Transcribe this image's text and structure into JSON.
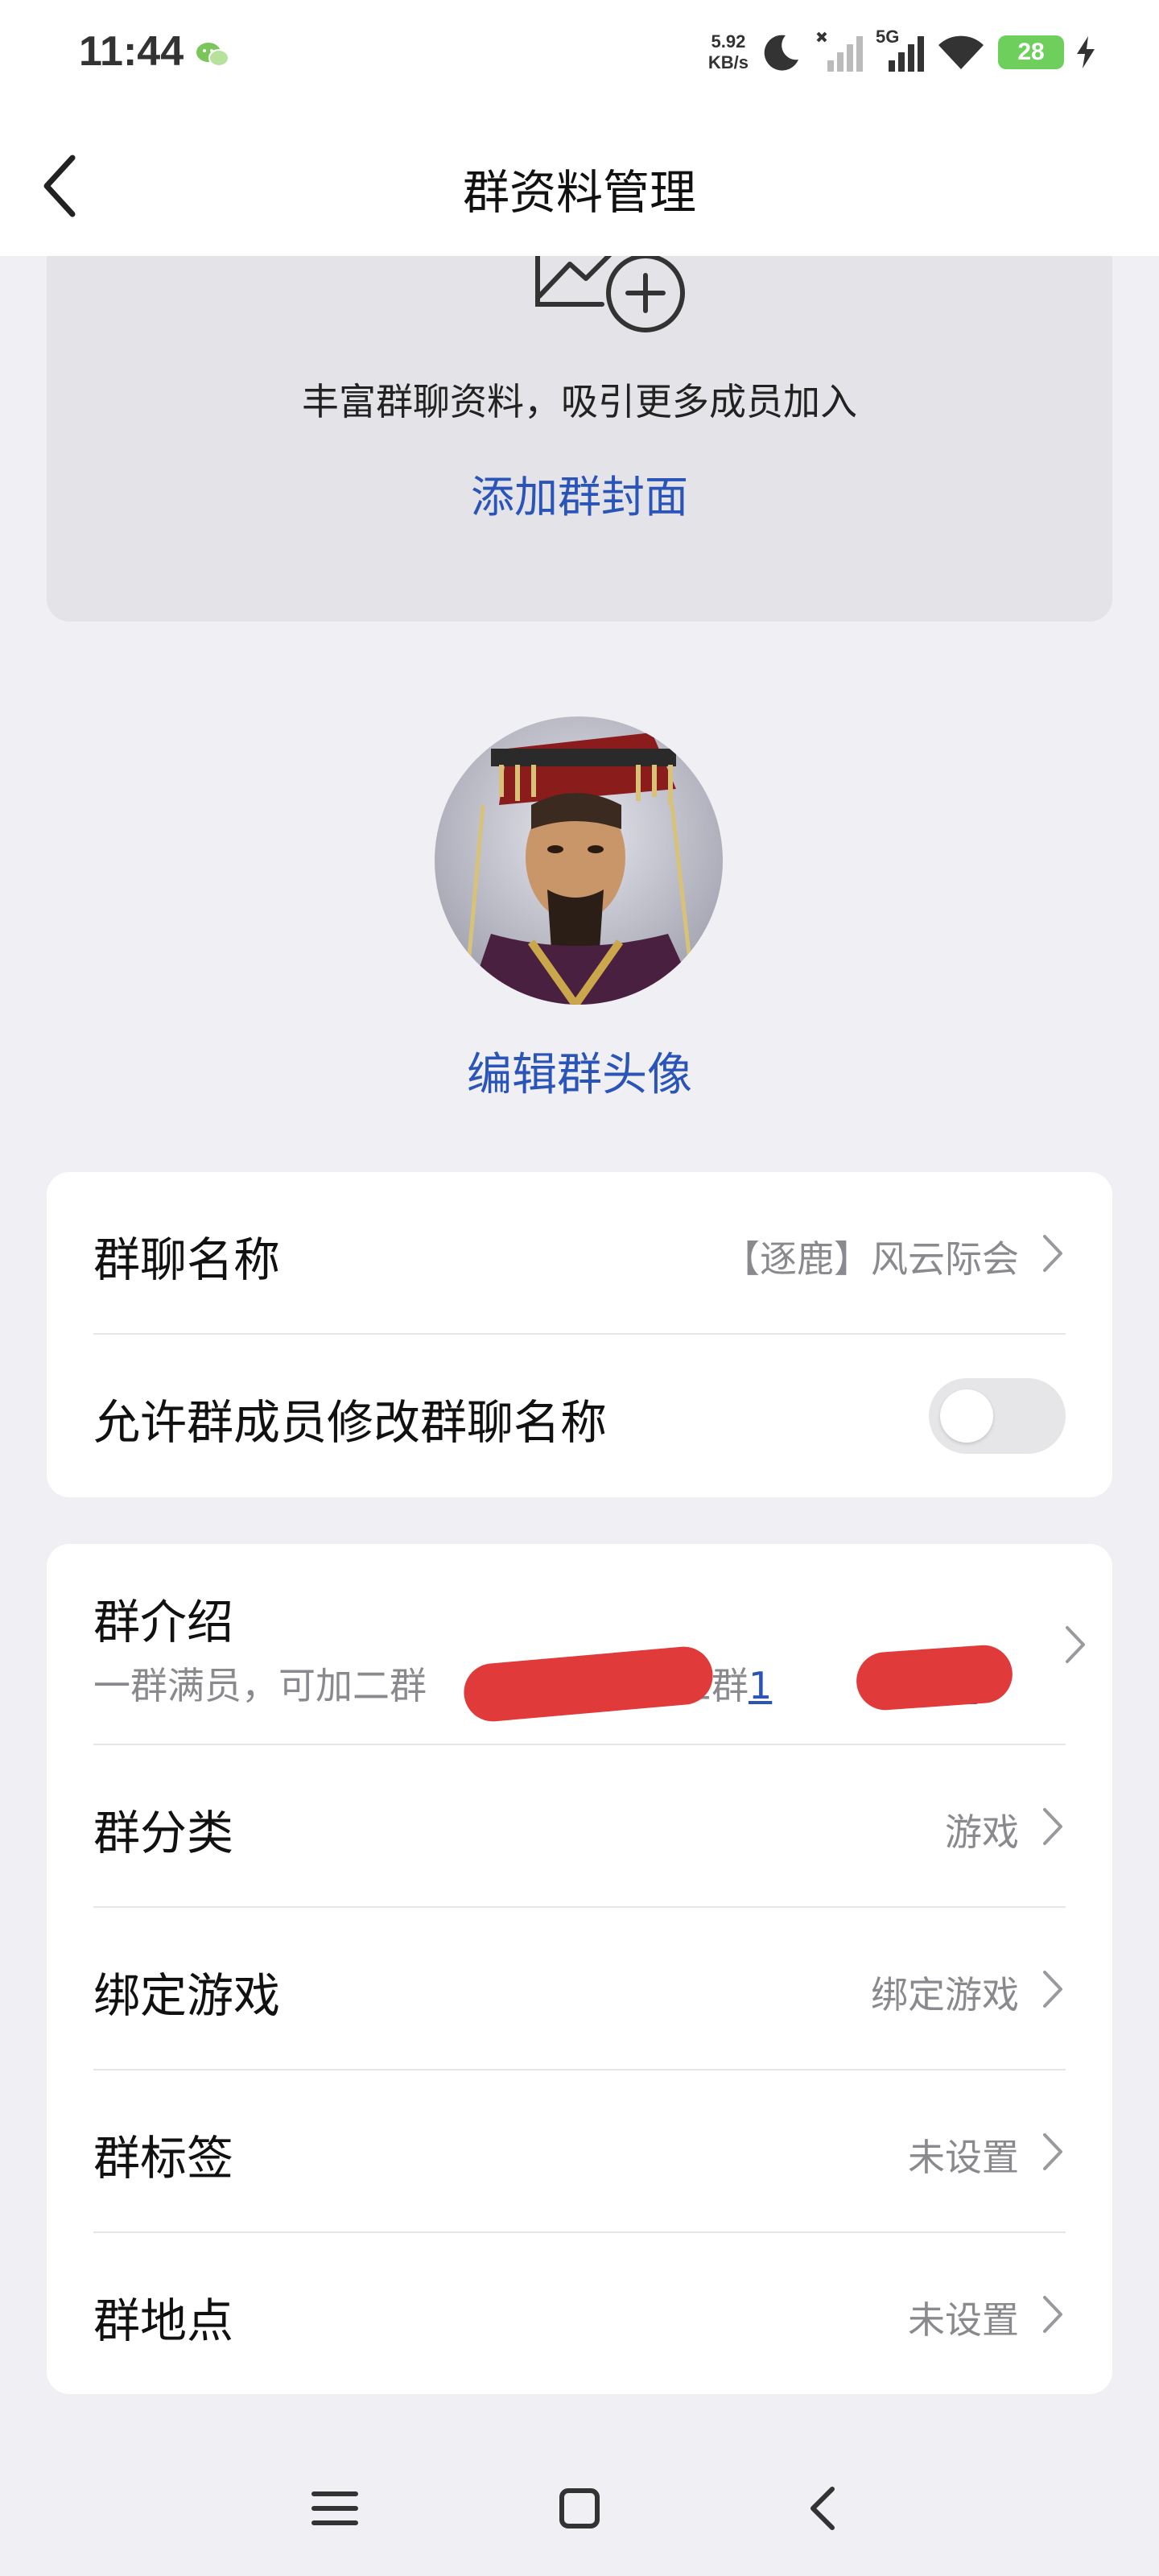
{
  "status_bar": {
    "time": "11:44",
    "net_speed_value": "5.92",
    "net_speed_unit": "KB/s",
    "network_type": "5G",
    "battery": "28"
  },
  "nav": {
    "title": "群资料管理"
  },
  "cover": {
    "description": "丰富群聊资料，吸引更多成员加入",
    "add_cover_label": "添加群封面"
  },
  "avatar": {
    "edit_label": "编辑群头像"
  },
  "name_card": {
    "group_name_label": "群聊名称",
    "group_name_value": "【逐鹿】风云际会",
    "allow_edit_label": "允许群成员修改群聊名称",
    "allow_edit_enabled": false
  },
  "info_card": {
    "intro_label": "群介绍",
    "intro_prefix": "一群满员，可加二群",
    "intro_link1_visible_end": "4",
    "intro_middle": "，三群",
    "intro_link2_visible_start": "1",
    "intro_link2_visible_end": "43",
    "category_label": "群分类",
    "category_value": "游戏",
    "bind_game_label": "绑定游戏",
    "bind_game_value": "绑定游戏",
    "tags_label": "群标签",
    "tags_value": "未设置",
    "location_label": "群地点",
    "location_value": "未设置"
  },
  "colors": {
    "accent_link": "#2a54b8",
    "background": "#efeff4",
    "redaction": "#e03a3a",
    "battery": "#6fcf5c"
  }
}
